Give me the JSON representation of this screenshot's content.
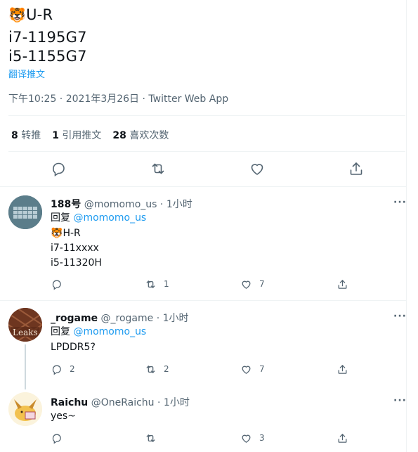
{
  "tweet": {
    "emoji": "🐯",
    "line1": "U-R",
    "line2": "i7-1195G7",
    "line3": "i5-1155G7",
    "translate": "翻译推文",
    "timestamp": "下午10:25 · 2021年3月26日 · Twitter Web App",
    "stats": {
      "retweets_count": "8",
      "retweets_label": "转推",
      "quotes_count": "1",
      "quotes_label": "引用推文",
      "likes_count": "28",
      "likes_label": "喜欢次数"
    },
    "actions": [
      "reply-icon",
      "retweet-icon",
      "like-icon",
      "share-icon"
    ]
  },
  "replies": [
    {
      "name": "188号",
      "handle": "@momomo_us",
      "time": "· 1小时",
      "replying_prefix": "回复",
      "replying_to": "@momomo_us",
      "emoji": "🐯",
      "lines": [
        "H-R",
        "i7-11xxxx",
        "i5-11320H"
      ],
      "reply_count": "",
      "retweet_count": "1",
      "like_count": "7",
      "more": "···"
    },
    {
      "name": "_rogame",
      "handle": "@_rogame",
      "time": "· 1小时",
      "replying_prefix": "回复",
      "replying_to": "@momomo_us",
      "lines": [
        "LPDDR5?"
      ],
      "avatar_text": "Leaks",
      "reply_count": "2",
      "retweet_count": "2",
      "like_count": "7",
      "more": "···"
    },
    {
      "name": "Raichu",
      "handle": "@OneRaichu",
      "time": "· 1小时",
      "lines": [
        "yes~"
      ],
      "reply_count": "",
      "retweet_count": "",
      "like_count": "3",
      "more": "···"
    }
  ],
  "colors": {
    "accent": "#1d9bf0",
    "text": "#0f1419",
    "secondary": "#536471",
    "divider": "#eff3f4"
  }
}
